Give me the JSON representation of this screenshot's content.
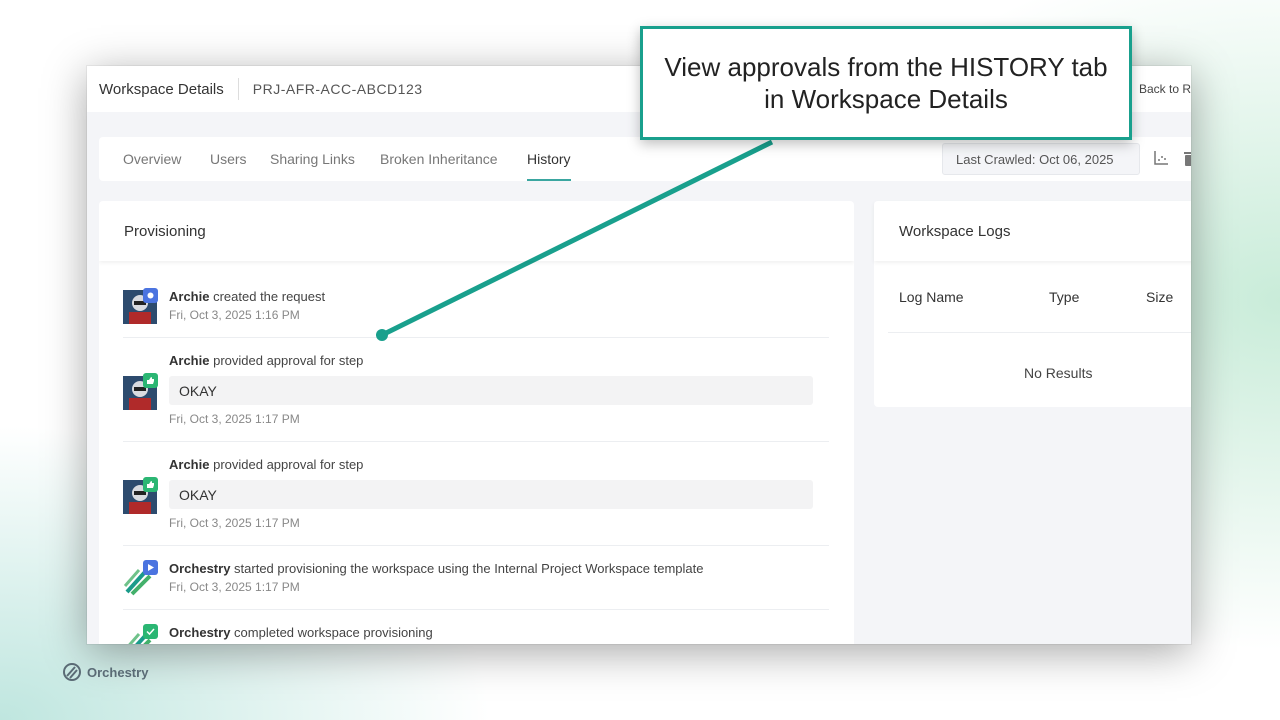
{
  "header": {
    "title": "Workspace Details",
    "code": "PRJ-AFR-ACC-ABCD123",
    "back_label": "Back to R"
  },
  "tabs": [
    {
      "label": "Overview",
      "active": false
    },
    {
      "label": "Users",
      "active": false
    },
    {
      "label": "Sharing Links",
      "active": false
    },
    {
      "label": "Broken Inheritance",
      "active": false
    },
    {
      "label": "History",
      "active": true
    }
  ],
  "toolbar": {
    "last_crawled": "Last Crawled: Oct 06, 2025",
    "icons": [
      "chart-icon",
      "trash-icon"
    ]
  },
  "provisioning": {
    "title": "Provisioning",
    "entries": [
      {
        "actor": "Archie",
        "action": "created the request",
        "time": "Fri, Oct 3, 2025 1:16 PM",
        "badge": "status-icon",
        "badge_color": "#4b74e0"
      },
      {
        "actor": "Archie",
        "action": "provided approval for step",
        "comment": "OKAY",
        "time": "Fri, Oct 3, 2025 1:17 PM",
        "badge": "thumbs-up-icon",
        "badge_color": "#2bb673"
      },
      {
        "actor": "Archie",
        "action": "provided approval for step",
        "comment": "OKAY",
        "time": "Fri, Oct 3, 2025 1:17 PM",
        "badge": "thumbs-up-icon",
        "badge_color": "#2bb673"
      },
      {
        "actor": "Orchestry",
        "action": "started provisioning the workspace using the Internal Project Workspace template",
        "time": "Fri, Oct 3, 2025 1:17 PM",
        "badge": "play-icon",
        "badge_color": "#4b74e0"
      },
      {
        "actor": "Orchestry",
        "action": "completed workspace provisioning",
        "badge": "check-icon",
        "badge_color": "#2bb673"
      }
    ]
  },
  "logs": {
    "title": "Workspace Logs",
    "columns": [
      "Log Name",
      "Type",
      "Size"
    ],
    "empty_text": "No Results"
  },
  "callout": {
    "line1": "View approvals from the HISTORY tab",
    "line2": "in Workspace Details"
  },
  "brand": {
    "name": "Orchestry"
  },
  "colors": {
    "accent": "#19a08d",
    "tab_underline": "#3aa6a0"
  }
}
